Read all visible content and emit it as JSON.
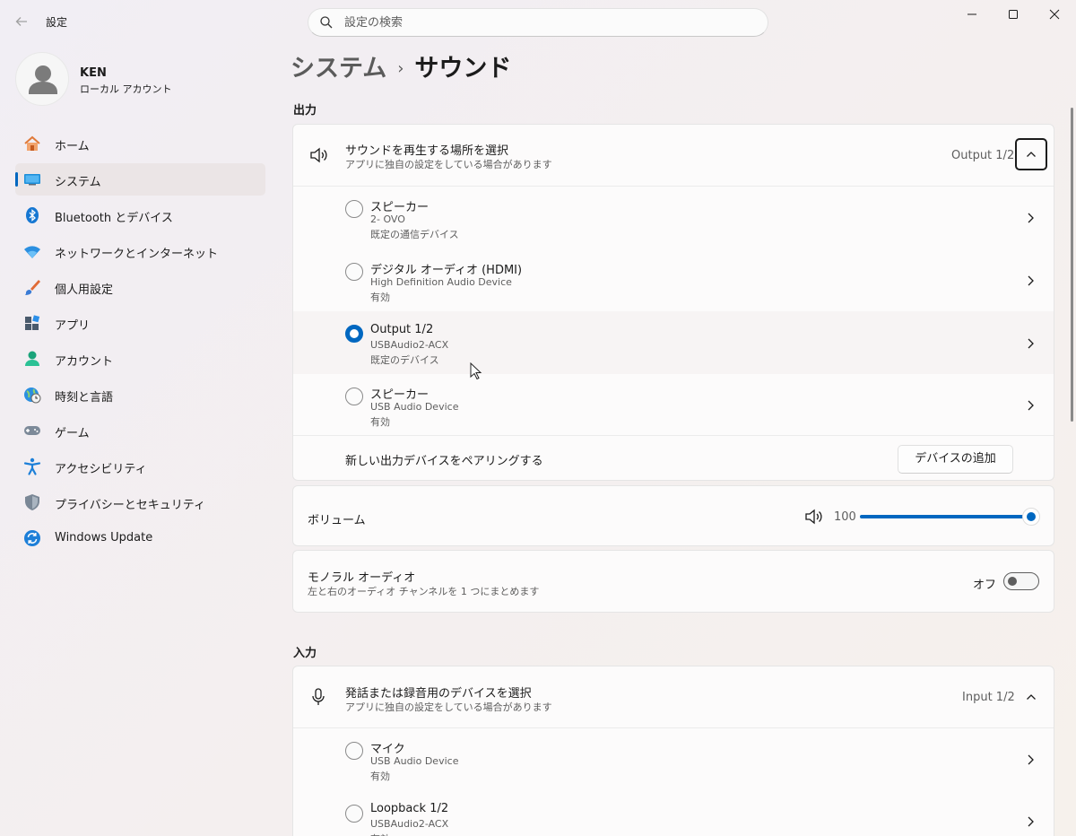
{
  "window": {
    "title": "設定",
    "search_placeholder": "設定の検索"
  },
  "profile": {
    "name": "KEN",
    "account_type": "ローカル アカウント"
  },
  "nav": [
    {
      "label": "ホーム",
      "icon": "home-icon"
    },
    {
      "label": "システム",
      "icon": "system-icon",
      "selected": true
    },
    {
      "label": "Bluetooth とデバイス",
      "icon": "bluetooth-icon"
    },
    {
      "label": "ネットワークとインターネット",
      "icon": "network-icon"
    },
    {
      "label": "個人用設定",
      "icon": "personalization-icon"
    },
    {
      "label": "アプリ",
      "icon": "apps-icon"
    },
    {
      "label": "アカウント",
      "icon": "account-icon"
    },
    {
      "label": "時刻と言語",
      "icon": "time-language-icon"
    },
    {
      "label": "ゲーム",
      "icon": "gaming-icon"
    },
    {
      "label": "アクセシビリティ",
      "icon": "accessibility-icon"
    },
    {
      "label": "プライバシーとセキュリティ",
      "icon": "privacy-shield-icon"
    },
    {
      "label": "Windows Update",
      "icon": "windows-update-icon"
    }
  ],
  "breadcrumb": {
    "parent": "システム",
    "separator": "›",
    "current": "サウンド"
  },
  "output": {
    "section_title": "出力",
    "header": {
      "title": "サウンドを再生する場所を選択",
      "subtitle": "アプリに独自の設定をしている場合があります",
      "value": "Output 1/2"
    },
    "devices": [
      {
        "name": "スピーカー",
        "line1": "2- OVO",
        "line2": "既定の通信デバイス",
        "selected": false
      },
      {
        "name": "デジタル オーディオ (HDMI)",
        "line1": "High Definition Audio Device",
        "line2": "有効",
        "selected": false
      },
      {
        "name": "Output 1/2",
        "line1": "USBAudio2-ACX",
        "line2": "既定のデバイス",
        "selected": true
      },
      {
        "name": "スピーカー",
        "line1": "USB Audio Device",
        "line2": "有効",
        "selected": false
      }
    ],
    "pair": {
      "label": "新しい出力デバイスをペアリングする",
      "button": "デバイスの追加"
    },
    "volume": {
      "label": "ボリューム",
      "value": "100",
      "level": 1.0
    },
    "mono": {
      "title": "モノラル オーディオ",
      "subtitle": "左と右のオーディオ チャンネルを 1 つにまとめます",
      "state": "オフ"
    }
  },
  "input": {
    "section_title": "入力",
    "header": {
      "title": "発話または録音用のデバイスを選択",
      "subtitle": "アプリに独自の設定をしている場合があります",
      "value": "Input 1/2"
    },
    "devices": [
      {
        "name": "マイク",
        "line1": "USB Audio Device",
        "line2": "有効",
        "selected": false
      },
      {
        "name": "Loopback 1/2",
        "line1": "USBAudio2-ACX",
        "line2": "有効",
        "selected": false
      }
    ]
  },
  "colors": {
    "accent": "#0067c0"
  }
}
